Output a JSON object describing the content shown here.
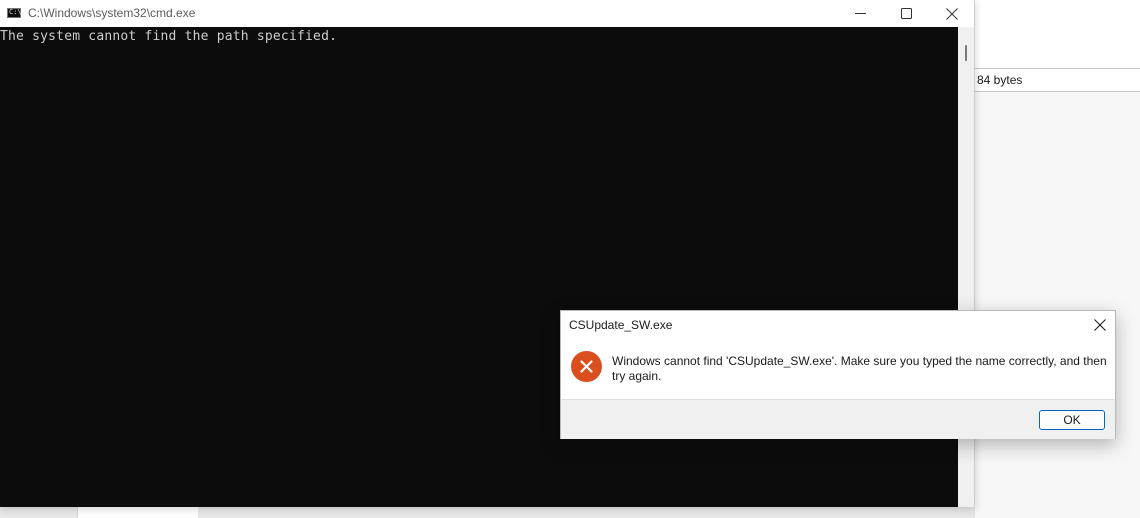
{
  "cmd_window": {
    "title": "C:\\Windows\\system32\\cmd.exe",
    "icon": "console-icon",
    "console_lines": [
      "The system cannot find the path specified."
    ],
    "controls": {
      "minimize_icon": "minimize-icon",
      "maximize_icon": "maximize-icon",
      "close_icon": "close-icon"
    },
    "colors": {
      "console_background": "#0c0c0c",
      "console_text": "#cccccc"
    }
  },
  "background_window": {
    "size_value": "84 bytes"
  },
  "error_dialog": {
    "title": "CSUpdate_SW.exe",
    "icon": "error-icon",
    "message": "Windows cannot find 'CSUpdate_SW.exe'. Make sure you typed the name correctly, and then try again.",
    "ok_label": "OK",
    "colors": {
      "error_icon": "#d94f1e",
      "ok_border": "#0067c0"
    }
  }
}
